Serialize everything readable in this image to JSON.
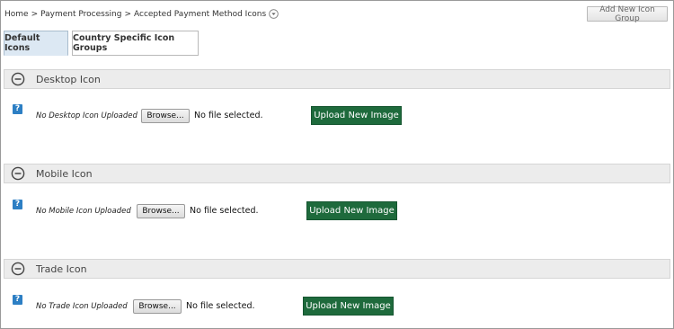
{
  "breadcrumb": {
    "items": [
      "Home",
      "Payment Processing",
      "Accepted Payment Method Icons"
    ],
    "separator": ">"
  },
  "header": {
    "add_group_label": "Add New Icon Group"
  },
  "tabs": [
    {
      "label": "Default Icons",
      "active": true
    },
    {
      "label": "Country Specific Icon Groups",
      "active": false
    }
  ],
  "sections": [
    {
      "title": "Desktop Icon",
      "status": "No Desktop Icon Uploaded",
      "browse_label": "Browse...",
      "file_status": "No file selected.",
      "upload_label": "Upload New Image",
      "help_glyph": "?"
    },
    {
      "title": "Mobile Icon",
      "status": "No Mobile Icon Uploaded",
      "browse_label": "Browse...",
      "file_status": "No file selected.",
      "upload_label": "Upload New Image",
      "help_glyph": "?"
    },
    {
      "title": "Trade Icon",
      "status": "No Trade Icon Uploaded",
      "browse_label": "Browse...",
      "file_status": "No file selected.",
      "upload_label": "Upload New Image",
      "help_glyph": "?"
    }
  ],
  "colors": {
    "upload_button": "#1e6a3c",
    "help_icon": "#2d7fc4",
    "active_tab": "#dce8f3",
    "section_header": "#ececec"
  }
}
